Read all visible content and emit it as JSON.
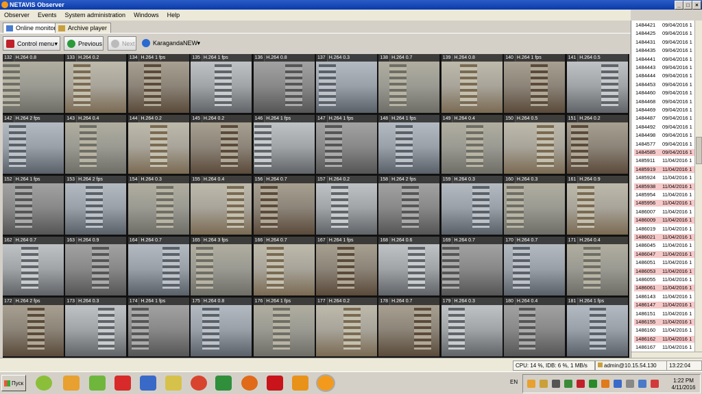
{
  "window": {
    "title": "NETAVIS Observer",
    "controls": [
      "_",
      "□",
      "×"
    ]
  },
  "menu": [
    "Observer",
    "Events",
    "System administration",
    "Windows",
    "Help"
  ],
  "tabs": [
    {
      "label": "Online monitor",
      "active": true
    },
    {
      "label": "Archive player",
      "active": false
    }
  ],
  "toolbar": {
    "control_menu": "Control menu",
    "previous": "Previous",
    "next": "Next",
    "location": "KaragandaNEW"
  },
  "cameras": [
    {
      "id": "132",
      "codec": "H.264",
      "rate": "0.8"
    },
    {
      "id": "133",
      "codec": "H.264",
      "rate": "0.2"
    },
    {
      "id": "134",
      "codec": "H.264",
      "rate": "1 fps"
    },
    {
      "id": "135",
      "codec": "H.264",
      "rate": "1 fps"
    },
    {
      "id": "136",
      "codec": "H.264",
      "rate": "0.8"
    },
    {
      "id": "137",
      "codec": "H.264",
      "rate": "0.3"
    },
    {
      "id": "138",
      "codec": "H.264",
      "rate": "0.7"
    },
    {
      "id": "139",
      "codec": "H.264",
      "rate": "0.8"
    },
    {
      "id": "140",
      "codec": "H.264",
      "rate": "1 fps"
    },
    {
      "id": "141",
      "codec": "H.264",
      "rate": "0.5"
    },
    {
      "id": "142",
      "codec": "H.264",
      "rate": "2 fps"
    },
    {
      "id": "143",
      "codec": "H.264",
      "rate": "0.4"
    },
    {
      "id": "144",
      "codec": "H.264",
      "rate": "0.2"
    },
    {
      "id": "145",
      "codec": "H.264",
      "rate": "0.2"
    },
    {
      "id": "146",
      "codec": "H.264",
      "rate": "1 fps"
    },
    {
      "id": "147",
      "codec": "H.264",
      "rate": "1 fps"
    },
    {
      "id": "148",
      "codec": "H.264",
      "rate": "1 fps"
    },
    {
      "id": "149",
      "codec": "H.264",
      "rate": "0.4"
    },
    {
      "id": "150",
      "codec": "H.264",
      "rate": "0.5"
    },
    {
      "id": "151",
      "codec": "H.264",
      "rate": "0.2"
    },
    {
      "id": "152",
      "codec": "H.264",
      "rate": "1 fps"
    },
    {
      "id": "153",
      "codec": "H.264",
      "rate": "2 fps"
    },
    {
      "id": "154",
      "codec": "H.264",
      "rate": "0.3"
    },
    {
      "id": "155",
      "codec": "H.264",
      "rate": "0.4"
    },
    {
      "id": "156",
      "codec": "H.264",
      "rate": "0.7"
    },
    {
      "id": "157",
      "codec": "H.264",
      "rate": "0.2"
    },
    {
      "id": "158",
      "codec": "H.264",
      "rate": "2 fps"
    },
    {
      "id": "159",
      "codec": "H.264",
      "rate": "0.3"
    },
    {
      "id": "160",
      "codec": "H.264",
      "rate": "0.3"
    },
    {
      "id": "161",
      "codec": "H.264",
      "rate": "0.9"
    },
    {
      "id": "162",
      "codec": "H.264",
      "rate": "0.7"
    },
    {
      "id": "163",
      "codec": "H.264",
      "rate": "0.9"
    },
    {
      "id": "164",
      "codec": "H.264",
      "rate": "0.7"
    },
    {
      "id": "165",
      "codec": "H.264",
      "rate": "3 fps"
    },
    {
      "id": "166",
      "codec": "H.264",
      "rate": "0.7"
    },
    {
      "id": "167",
      "codec": "H.264",
      "rate": "1 fps"
    },
    {
      "id": "168",
      "codec": "H.264",
      "rate": "0.6"
    },
    {
      "id": "169",
      "codec": "H.264",
      "rate": "0.7"
    },
    {
      "id": "170",
      "codec": "H.264",
      "rate": "0.7"
    },
    {
      "id": "171",
      "codec": "H.264",
      "rate": "0.4"
    },
    {
      "id": "172",
      "codec": "H.264",
      "rate": "2 fps"
    },
    {
      "id": "173",
      "codec": "H.264",
      "rate": "0.3"
    },
    {
      "id": "174",
      "codec": "H.264",
      "rate": "1 fps"
    },
    {
      "id": "175",
      "codec": "H.264",
      "rate": "0.8"
    },
    {
      "id": "176",
      "codec": "H.264",
      "rate": "1 fps"
    },
    {
      "id": "177",
      "codec": "H.264",
      "rate": "0.2"
    },
    {
      "id": "178",
      "codec": "H.264",
      "rate": "0.7"
    },
    {
      "id": "179",
      "codec": "H.264",
      "rate": "0.3"
    },
    {
      "id": "180",
      "codec": "H.264",
      "rate": "0.4"
    },
    {
      "id": "181",
      "codec": "H.264",
      "rate": "1 fps"
    }
  ],
  "events": [
    {
      "id": "1484421",
      "date": "09/04/2016 1"
    },
    {
      "id": "1484425",
      "date": "09/04/2016 1"
    },
    {
      "id": "1484431",
      "date": "09/04/2016 1"
    },
    {
      "id": "1484435",
      "date": "09/04/2016 1"
    },
    {
      "id": "1484441",
      "date": "09/04/2016 1"
    },
    {
      "id": "1484443",
      "date": "09/04/2016 1"
    },
    {
      "id": "1484444",
      "date": "09/04/2016 1"
    },
    {
      "id": "1484453",
      "date": "09/04/2016 1"
    },
    {
      "id": "1484460",
      "date": "09/04/2016 1"
    },
    {
      "id": "1484468",
      "date": "09/04/2016 1"
    },
    {
      "id": "1484469",
      "date": "09/04/2016 1"
    },
    {
      "id": "1484487",
      "date": "09/04/2016 1"
    },
    {
      "id": "1484492",
      "date": "09/04/2016 1"
    },
    {
      "id": "1484498",
      "date": "09/04/2016 1"
    },
    {
      "id": "1484577",
      "date": "09/04/2016 1"
    },
    {
      "id": "1484585",
      "date": "09/04/2016 1"
    },
    {
      "id": "1485911",
      "date": "11/04/2016 1"
    },
    {
      "id": "1485919",
      "date": "11/04/2016 1"
    },
    {
      "id": "1485924",
      "date": "11/04/2016 1"
    },
    {
      "id": "1485938",
      "date": "11/04/2016 1"
    },
    {
      "id": "1485954",
      "date": "11/04/2016 1"
    },
    {
      "id": "1485956",
      "date": "11/04/2016 1"
    },
    {
      "id": "1486007",
      "date": "11/04/2016 1"
    },
    {
      "id": "1486009",
      "date": "11/04/2016 1"
    },
    {
      "id": "1486019",
      "date": "11/04/2016 1"
    },
    {
      "id": "1486021",
      "date": "11/04/2016 1"
    },
    {
      "id": "1486045",
      "date": "11/04/2016 1"
    },
    {
      "id": "1486047",
      "date": "11/04/2016 1"
    },
    {
      "id": "1486051",
      "date": "11/04/2016 1"
    },
    {
      "id": "1486053",
      "date": "11/04/2016 1"
    },
    {
      "id": "1486055",
      "date": "11/04/2016 1"
    },
    {
      "id": "1486061",
      "date": "11/04/2016 1"
    },
    {
      "id": "1486143",
      "date": "11/04/2016 1"
    },
    {
      "id": "1486147",
      "date": "11/04/2016 1"
    },
    {
      "id": "1486151",
      "date": "11/04/2016 1"
    },
    {
      "id": "1486155",
      "date": "11/04/2016 1"
    },
    {
      "id": "1486160",
      "date": "11/04/2016 1"
    },
    {
      "id": "1486162",
      "date": "11/04/2016 1"
    },
    {
      "id": "1486167",
      "date": "11/04/2016 1"
    }
  ],
  "status": {
    "cpu": "CPU: 14 %, IDB: 6 %, 1 MB/s",
    "user": "admin@10.15.54.130",
    "time": "13:22:04 BST"
  },
  "taskbar": {
    "start": "Пуск",
    "lang": "EN",
    "clock_time": "1:22 PM",
    "clock_date": "4/11/2016"
  },
  "colors": {
    "title_bar": "#0a3aa8",
    "event_highlight": "#f6c9c9",
    "overlay": "#282828"
  }
}
